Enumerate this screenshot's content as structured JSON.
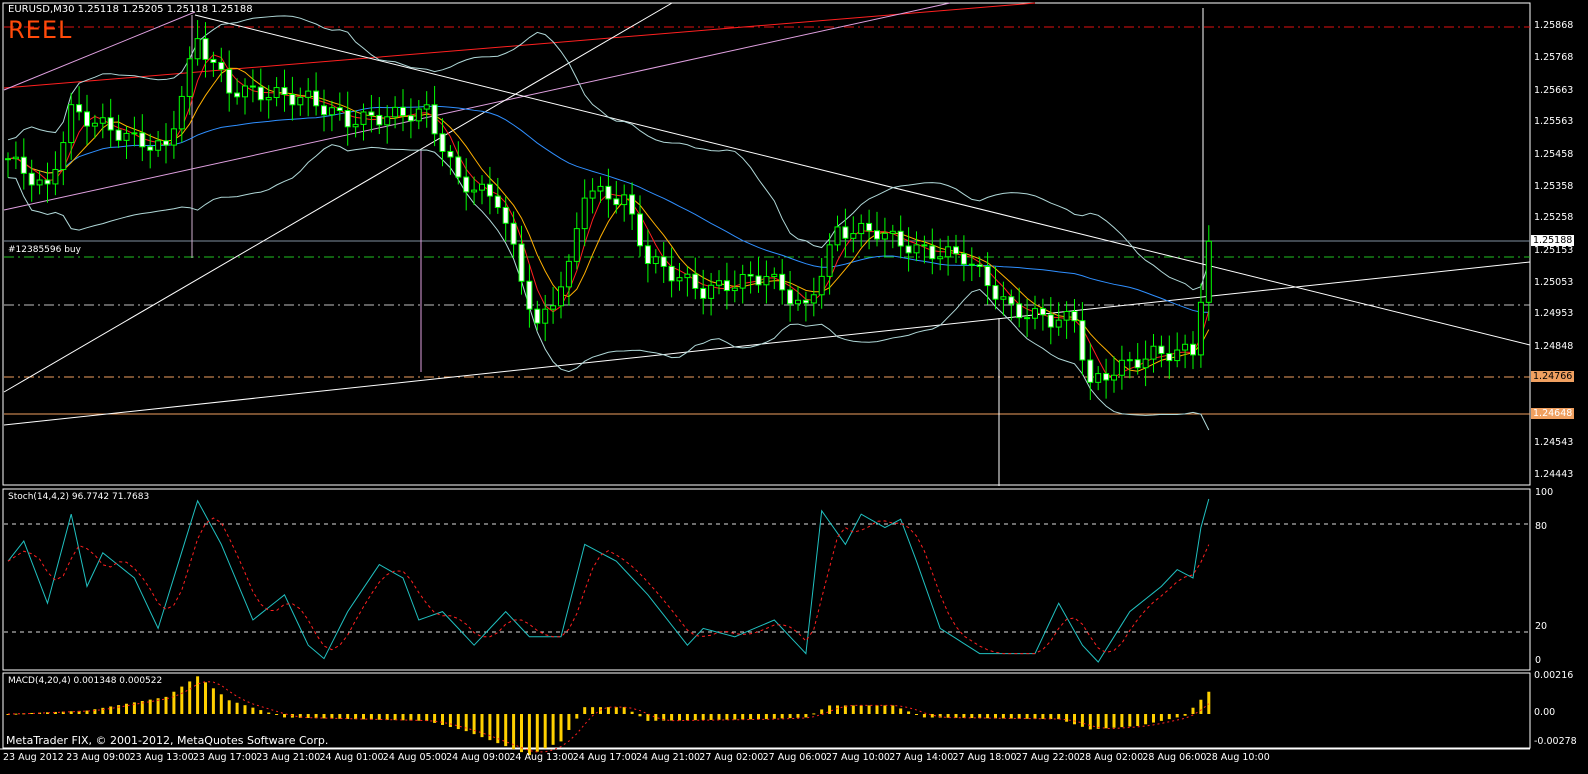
{
  "header": {
    "symbol_info": "EURUSD,M30  1.25118 1.25205 1.25118 1.25188",
    "label": "REEL"
  },
  "order_label": "#12385596 buy",
  "footer": "MetaTrader FIX, © 2001-2012, MetaQuotes Software Corp.",
  "colors": {
    "bull": "#00ff00",
    "bear": "#ffffff",
    "ma_blue": "#2f8fff",
    "ma_red": "#ff2020",
    "ma_orange": "#ffb000",
    "stoch_main": "#20c0c0",
    "stoch_signal": "#ff2020",
    "macd_hist": "#ffd000",
    "orange": "#f0a060"
  },
  "price_axis": [
    "1.25868",
    "1.25768",
    "1.25663",
    "1.25563",
    "1.25458",
    "1.25358",
    "1.25258",
    "1.25153",
    "1.25053",
    "1.24953",
    "1.24848",
    "1.24748",
    "1.24543",
    "1.24443"
  ],
  "price_tags": {
    "current": "1.25188",
    "level1": "1.24766",
    "level2": "1.24648"
  },
  "stoch": {
    "label": "Stoch(14,4,2) 96.7742 71.7683",
    "axis": [
      "100",
      "80",
      "20",
      "0"
    ]
  },
  "macd": {
    "label": "MACD(4,20,4) 0.001348 0.000522",
    "axis": [
      "0.00216",
      "0.00",
      "-0.00278"
    ]
  },
  "time_axis": [
    "23 Aug 2012",
    "23 Aug 09:00",
    "23 Aug 13:00",
    "23 Aug 17:00",
    "23 Aug 21:00",
    "24 Aug 01:00",
    "24 Aug 05:00",
    "24 Aug 09:00",
    "24 Aug 13:00",
    "24 Aug 17:00",
    "24 Aug 21:00",
    "27 Aug 02:00",
    "27 Aug 06:00",
    "27 Aug 10:00",
    "27 Aug 14:00",
    "27 Aug 18:00",
    "27 Aug 22:00",
    "28 Aug 02:00",
    "28 Aug 06:00",
    "28 Aug 10:00"
  ],
  "chart_data": {
    "type": "candlestick",
    "symbol": "EURUSD",
    "timeframe": "M30",
    "ylim": [
      1.24443,
      1.25868
    ],
    "bars": 153,
    "close_path": [
      [
        0,
        1.2545
      ],
      [
        5,
        1.2535
      ],
      [
        8,
        1.256
      ],
      [
        16,
        1.2551
      ],
      [
        20,
        1.2548
      ],
      [
        24,
        1.2583
      ],
      [
        28,
        1.2567
      ],
      [
        38,
        1.2564
      ],
      [
        43,
        1.2557
      ],
      [
        53,
        1.256
      ],
      [
        57,
        1.2538
      ],
      [
        62,
        1.2532
      ],
      [
        67,
        1.2491
      ],
      [
        71,
        1.251
      ],
      [
        73,
        1.2535
      ],
      [
        78,
        1.2532
      ],
      [
        81,
        1.2513
      ],
      [
        88,
        1.2503
      ],
      [
        96,
        1.2508
      ],
      [
        101,
        1.2497
      ],
      [
        105,
        1.2522
      ],
      [
        110,
        1.2522
      ],
      [
        115,
        1.2516
      ],
      [
        121,
        1.2514
      ],
      [
        127,
        1.2497
      ],
      [
        132,
        1.2494
      ],
      [
        135,
        1.2494
      ],
      [
        137,
        1.2473
      ],
      [
        140,
        1.2478
      ],
      [
        145,
        1.2483
      ],
      [
        150,
        1.2484
      ],
      [
        152,
        1.25188
      ]
    ],
    "stoch_main": [
      [
        0,
        60
      ],
      [
        2,
        72
      ],
      [
        5,
        35
      ],
      [
        8,
        88
      ],
      [
        10,
        45
      ],
      [
        12,
        65
      ],
      [
        16,
        50
      ],
      [
        19,
        20
      ],
      [
        24,
        96
      ],
      [
        27,
        70
      ],
      [
        31,
        25
      ],
      [
        35,
        40
      ],
      [
        38,
        10
      ],
      [
        40,
        2
      ],
      [
        43,
        30
      ],
      [
        47,
        58
      ],
      [
        50,
        50
      ],
      [
        52,
        25
      ],
      [
        55,
        30
      ],
      [
        59,
        10
      ],
      [
        63,
        30
      ],
      [
        66,
        15
      ],
      [
        70,
        15
      ],
      [
        73,
        70
      ],
      [
        77,
        60
      ],
      [
        81,
        40
      ],
      [
        86,
        10
      ],
      [
        88,
        20
      ],
      [
        92,
        15
      ],
      [
        97,
        25
      ],
      [
        101,
        5
      ],
      [
        103,
        90
      ],
      [
        106,
        70
      ],
      [
        108,
        88
      ],
      [
        111,
        80
      ],
      [
        113,
        85
      ],
      [
        115,
        60
      ],
      [
        118,
        20
      ],
      [
        123,
        5
      ],
      [
        130,
        5
      ],
      [
        133,
        35
      ],
      [
        136,
        10
      ],
      [
        138,
        0
      ],
      [
        142,
        30
      ],
      [
        146,
        45
      ],
      [
        148,
        55
      ],
      [
        150,
        50
      ],
      [
        151,
        80
      ],
      [
        152,
        97
      ]
    ],
    "macd_path": [
      [
        0,
        0.0
      ],
      [
        10,
        0.0002
      ],
      [
        20,
        0.001
      ],
      [
        24,
        0.0022
      ],
      [
        28,
        0.0008
      ],
      [
        35,
        -0.0002
      ],
      [
        53,
        -0.0004
      ],
      [
        58,
        -0.001
      ],
      [
        66,
        -0.0024
      ],
      [
        70,
        -0.0016
      ],
      [
        73,
        0.0004
      ],
      [
        78,
        0.0004
      ],
      [
        81,
        -0.0004
      ],
      [
        96,
        -0.0003
      ],
      [
        101,
        -0.0002
      ],
      [
        104,
        0.0005
      ],
      [
        112,
        0.0005
      ],
      [
        116,
        -0.0002
      ],
      [
        133,
        -0.0003
      ],
      [
        137,
        -0.0009
      ],
      [
        143,
        -0.0007
      ],
      [
        149,
        -0.0001
      ],
      [
        152,
        0.0013
      ]
    ]
  }
}
